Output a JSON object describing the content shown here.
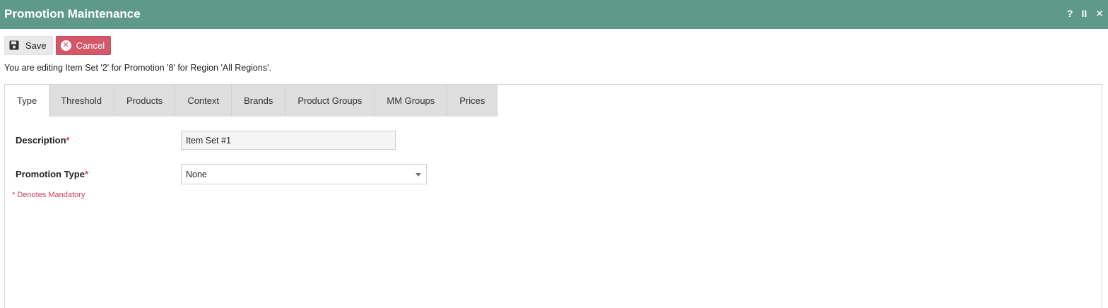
{
  "window": {
    "title": "Promotion Maintenance",
    "controls": {
      "help": "?",
      "pause": "II",
      "close": "✕"
    }
  },
  "toolbar": {
    "save_label": "Save",
    "cancel_label": "Cancel"
  },
  "edit_message": "You are editing Item Set '2' for Promotion '8' for Region 'All Regions'.",
  "tabs": [
    {
      "label": "Type"
    },
    {
      "label": "Threshold"
    },
    {
      "label": "Products"
    },
    {
      "label": "Context"
    },
    {
      "label": "Brands"
    },
    {
      "label": "Product Groups"
    },
    {
      "label": "MM Groups"
    },
    {
      "label": "Prices"
    }
  ],
  "form": {
    "description_label": "Description",
    "description_value": "Item Set #1",
    "promotion_type_label": "Promotion Type",
    "promotion_type_value": "None",
    "required_marker": "*",
    "mandatory_note": "* Denotes Mandatory"
  },
  "colors": {
    "titlebar": "#5f998a",
    "cancel": "#d45868",
    "required": "#d1415a"
  }
}
